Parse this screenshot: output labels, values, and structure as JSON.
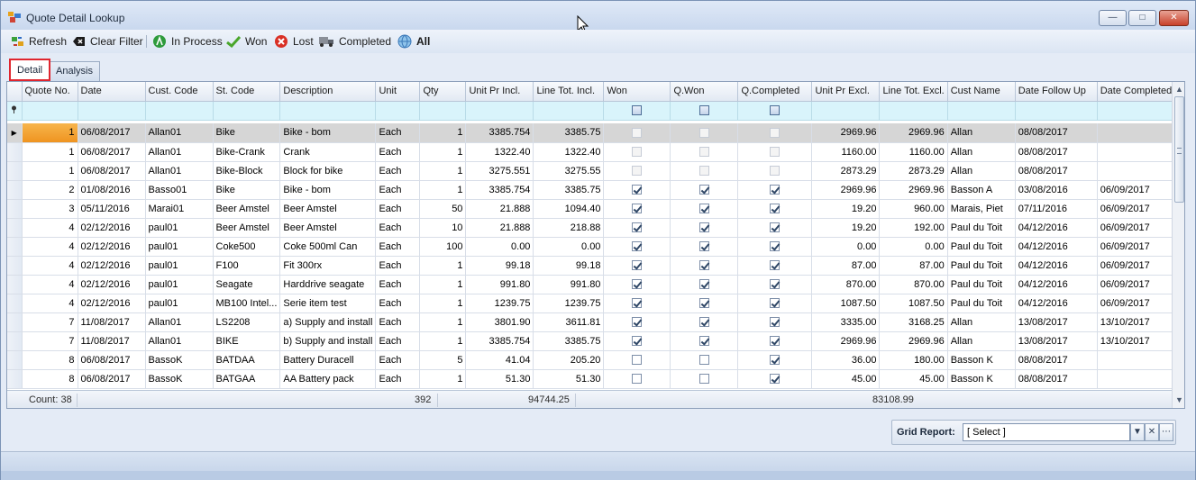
{
  "window": {
    "title": "Quote Detail Lookup"
  },
  "toolbar": {
    "refresh": "Refresh",
    "clear_filter": "Clear Filter",
    "in_process": "In Process",
    "won": "Won",
    "lost": "Lost",
    "completed": "Completed",
    "all": "All"
  },
  "tabs": {
    "detail": "Detail",
    "analysis": "Analysis"
  },
  "grid": {
    "columns": [
      "Quote No.",
      "Date",
      "Cust. Code",
      "St. Code",
      "Description",
      "Unit",
      "Qty",
      "Unit Pr Incl.",
      "Line Tot. Incl.",
      "Won",
      "Q.Won",
      "Q.Completed",
      "Unit Pr Excl.",
      "Line Tot. Excl.",
      "Cust Name",
      "Date Follow Up",
      "Date Completed"
    ],
    "rows": [
      {
        "quote_no": "1",
        "date": "06/08/2017",
        "cust_code": "Allan01",
        "st_code": "Bike",
        "description": "Bike - bom",
        "unit": "Each",
        "qty": "1",
        "unit_pr_incl": "3385.754",
        "line_tot_incl": "3385.75",
        "won": false,
        "q_won": false,
        "q_completed": false,
        "unit_pr_excl": "2969.96",
        "line_tot_excl": "2969.96",
        "cust_name": "Allan",
        "date_follow_up": "08/08/2017",
        "date_completed": ""
      },
      {
        "quote_no": "1",
        "date": "06/08/2017",
        "cust_code": "Allan01",
        "st_code": "Bike-Crank",
        "description": "Crank",
        "unit": "Each",
        "qty": "1",
        "unit_pr_incl": "1322.40",
        "line_tot_incl": "1322.40",
        "won": false,
        "q_won": false,
        "q_completed": false,
        "unit_pr_excl": "1160.00",
        "line_tot_excl": "1160.00",
        "cust_name": "Allan",
        "date_follow_up": "08/08/2017",
        "date_completed": ""
      },
      {
        "quote_no": "1",
        "date": "06/08/2017",
        "cust_code": "Allan01",
        "st_code": "Bike-Block",
        "description": "Block for bike",
        "unit": "Each",
        "qty": "1",
        "unit_pr_incl": "3275.551",
        "line_tot_incl": "3275.55",
        "won": false,
        "q_won": false,
        "q_completed": false,
        "unit_pr_excl": "2873.29",
        "line_tot_excl": "2873.29",
        "cust_name": "Allan",
        "date_follow_up": "08/08/2017",
        "date_completed": ""
      },
      {
        "quote_no": "2",
        "date": "01/08/2016",
        "cust_code": "Basso01",
        "st_code": "Bike",
        "description": "Bike - bom",
        "unit": "Each",
        "qty": "1",
        "unit_pr_incl": "3385.754",
        "line_tot_incl": "3385.75",
        "won": true,
        "q_won": true,
        "q_completed": true,
        "unit_pr_excl": "2969.96",
        "line_tot_excl": "2969.96",
        "cust_name": "Basson A",
        "date_follow_up": "03/08/2016",
        "date_completed": "06/09/2017"
      },
      {
        "quote_no": "3",
        "date": "05/11/2016",
        "cust_code": "Marai01",
        "st_code": "Beer Amstel",
        "description": "Beer Amstel",
        "unit": "Each",
        "qty": "50",
        "unit_pr_incl": "21.888",
        "line_tot_incl": "1094.40",
        "won": true,
        "q_won": true,
        "q_completed": true,
        "unit_pr_excl": "19.20",
        "line_tot_excl": "960.00",
        "cust_name": "Marais, Piet",
        "date_follow_up": "07/11/2016",
        "date_completed": "06/09/2017"
      },
      {
        "quote_no": "4",
        "date": "02/12/2016",
        "cust_code": "paul01",
        "st_code": "Beer Amstel",
        "description": "Beer Amstel",
        "unit": "Each",
        "qty": "10",
        "unit_pr_incl": "21.888",
        "line_tot_incl": "218.88",
        "won": true,
        "q_won": true,
        "q_completed": true,
        "unit_pr_excl": "19.20",
        "line_tot_excl": "192.00",
        "cust_name": "Paul du Toit",
        "date_follow_up": "04/12/2016",
        "date_completed": "06/09/2017"
      },
      {
        "quote_no": "4",
        "date": "02/12/2016",
        "cust_code": "paul01",
        "st_code": "Coke500",
        "description": "Coke 500ml Can",
        "unit": "Each",
        "qty": "100",
        "unit_pr_incl": "0.00",
        "line_tot_incl": "0.00",
        "won": true,
        "q_won": true,
        "q_completed": true,
        "unit_pr_excl": "0.00",
        "line_tot_excl": "0.00",
        "cust_name": "Paul du Toit",
        "date_follow_up": "04/12/2016",
        "date_completed": "06/09/2017"
      },
      {
        "quote_no": "4",
        "date": "02/12/2016",
        "cust_code": "paul01",
        "st_code": "F100",
        "description": "Fit 300rx",
        "unit": "Each",
        "qty": "1",
        "unit_pr_incl": "99.18",
        "line_tot_incl": "99.18",
        "won": true,
        "q_won": true,
        "q_completed": true,
        "unit_pr_excl": "87.00",
        "line_tot_excl": "87.00",
        "cust_name": "Paul du Toit",
        "date_follow_up": "04/12/2016",
        "date_completed": "06/09/2017"
      },
      {
        "quote_no": "4",
        "date": "02/12/2016",
        "cust_code": "paul01",
        "st_code": "Seagate",
        "description": "Harddrive seagate",
        "unit": "Each",
        "qty": "1",
        "unit_pr_incl": "991.80",
        "line_tot_incl": "991.80",
        "won": true,
        "q_won": true,
        "q_completed": true,
        "unit_pr_excl": "870.00",
        "line_tot_excl": "870.00",
        "cust_name": "Paul du Toit",
        "date_follow_up": "04/12/2016",
        "date_completed": "06/09/2017"
      },
      {
        "quote_no": "4",
        "date": "02/12/2016",
        "cust_code": "paul01",
        "st_code": "MB100 Intel...",
        "description": "Serie item test",
        "unit": "Each",
        "qty": "1",
        "unit_pr_incl": "1239.75",
        "line_tot_incl": "1239.75",
        "won": true,
        "q_won": true,
        "q_completed": true,
        "unit_pr_excl": "1087.50",
        "line_tot_excl": "1087.50",
        "cust_name": "Paul du Toit",
        "date_follow_up": "04/12/2016",
        "date_completed": "06/09/2017"
      },
      {
        "quote_no": "7",
        "date": "11/08/2017",
        "cust_code": "Allan01",
        "st_code": "LS2208",
        "description": "a) Supply and install",
        "unit": "Each",
        "qty": "1",
        "unit_pr_incl": "3801.90",
        "line_tot_incl": "3611.81",
        "won": true,
        "q_won": true,
        "q_completed": true,
        "unit_pr_excl": "3335.00",
        "line_tot_excl": "3168.25",
        "cust_name": "Allan",
        "date_follow_up": "13/08/2017",
        "date_completed": "13/10/2017"
      },
      {
        "quote_no": "7",
        "date": "11/08/2017",
        "cust_code": "Allan01",
        "st_code": "BIKE",
        "description": "b) Supply and install",
        "unit": "Each",
        "qty": "1",
        "unit_pr_incl": "3385.754",
        "line_tot_incl": "3385.75",
        "won": true,
        "q_won": true,
        "q_completed": true,
        "unit_pr_excl": "2969.96",
        "line_tot_excl": "2969.96",
        "cust_name": "Allan",
        "date_follow_up": "13/08/2017",
        "date_completed": "13/10/2017"
      },
      {
        "quote_no": "8",
        "date": "06/08/2017",
        "cust_code": "BassoK",
        "st_code": "BATDAA",
        "description": "Battery Duracell",
        "unit": "Each",
        "qty": "5",
        "unit_pr_incl": "41.04",
        "line_tot_incl": "205.20",
        "won": false,
        "q_won": false,
        "q_completed": true,
        "unit_pr_excl": "36.00",
        "line_tot_excl": "180.00",
        "cust_name": "Basson K",
        "date_follow_up": "08/08/2017",
        "date_completed": ""
      },
      {
        "quote_no": "8",
        "date": "06/08/2017",
        "cust_code": "BassoK",
        "st_code": "BATGAA",
        "description": "AA Battery pack",
        "unit": "Each",
        "qty": "1",
        "unit_pr_incl": "51.30",
        "line_tot_incl": "51.30",
        "won": false,
        "q_won": false,
        "q_completed": true,
        "unit_pr_excl": "45.00",
        "line_tot_excl": "45.00",
        "cust_name": "Basson K",
        "date_follow_up": "08/08/2017",
        "date_completed": ""
      }
    ],
    "footer": {
      "count": "Count: 38",
      "qty_total": "392",
      "line_tot_incl_total": "94744.25",
      "line_tot_excl_total": "83108.99"
    }
  },
  "grid_report": {
    "label": "Grid Report:",
    "selected": "[ Select ]"
  }
}
